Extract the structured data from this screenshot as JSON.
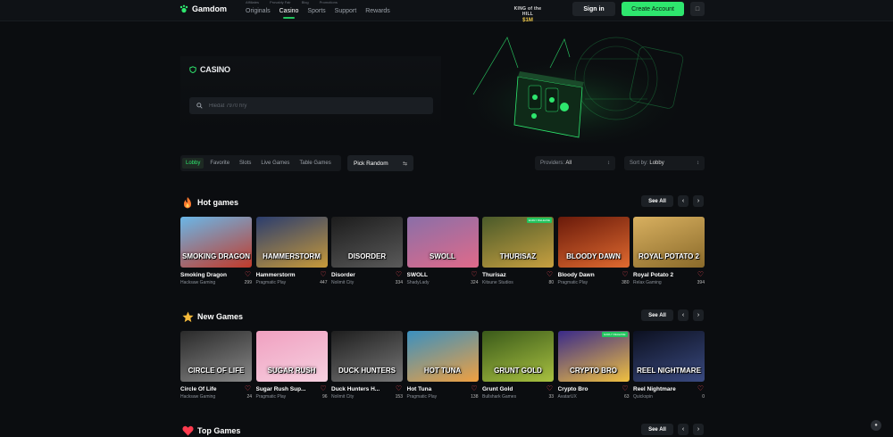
{
  "header": {
    "brand": "Gamdom",
    "subnav": [
      "Affiliates",
      "Provably Fair",
      "Blog",
      "Promotions"
    ],
    "nav": [
      "Originals",
      "Casino",
      "Sports",
      "Support",
      "Rewards"
    ],
    "king_title": "KING of the HILL",
    "king_prize": "$1M",
    "signin": "Sign in",
    "create": "Create Account"
  },
  "hero": {
    "title": "CASINO",
    "search_placeholder": "Hledat 7970 hry"
  },
  "filters": {
    "tabs": [
      "Lobby",
      "Favorite",
      "Slots",
      "Live Games",
      "Table Games"
    ],
    "pick_random": "Pick Random",
    "providers_label": "Providers:",
    "providers_value": "All",
    "sort_label": "Sort by:",
    "sort_value": "Lobby"
  },
  "colors": {
    "accent": "#2ee66e",
    "heart": "#ff4d5a",
    "bg": "#0b0d10"
  },
  "sections": [
    {
      "title": "Hot games",
      "icon": "fire-icon",
      "see_all": "See All",
      "games": [
        {
          "name": "Smoking Dragon",
          "provider": "Hacksaw Gaming",
          "likes": "299",
          "art": "SMOKING DRAGON",
          "badge": ""
        },
        {
          "name": "Hammerstorm",
          "provider": "Pragmatic Play",
          "likes": "447",
          "art": "HAMMERSTORM",
          "badge": ""
        },
        {
          "name": "Disorder",
          "provider": "Nolimit City",
          "likes": "334",
          "art": "DISORDER",
          "badge": ""
        },
        {
          "name": "SWOLL",
          "provider": "ShadyLady",
          "likes": "324",
          "art": "SWOLL",
          "badge": ""
        },
        {
          "name": "Thurisaz",
          "provider": "Kitsune Studios",
          "likes": "80",
          "art": "THURISAZ",
          "badge": "EARLY RELEASE"
        },
        {
          "name": "Bloody Dawn",
          "provider": "Pragmatic Play",
          "likes": "380",
          "art": "BLOODY DAWN",
          "badge": ""
        },
        {
          "name": "Royal Potato 2",
          "provider": "Relax Gaming",
          "likes": "394",
          "art": "ROYAL POTATO 2",
          "badge": ""
        }
      ]
    },
    {
      "title": "New Games",
      "icon": "star-icon",
      "see_all": "See All",
      "games": [
        {
          "name": "Circle Of Life",
          "provider": "Hacksaw Gaming",
          "likes": "24",
          "art": "CIRCLE OF LIFE",
          "badge": ""
        },
        {
          "name": "Sugar Rush Sup...",
          "provider": "Pragmatic Play",
          "likes": "96",
          "art": "SUGAR RUSH",
          "badge": ""
        },
        {
          "name": "Duck Hunters H...",
          "provider": "Nolimit City",
          "likes": "153",
          "art": "DUCK HUNTERS",
          "badge": ""
        },
        {
          "name": "Hot Tuna",
          "provider": "Pragmatic Play",
          "likes": "138",
          "art": "HOT TUNA",
          "badge": ""
        },
        {
          "name": "Grunt Gold",
          "provider": "Bullshark Games",
          "likes": "33",
          "art": "GRUNT GOLD",
          "badge": ""
        },
        {
          "name": "Crypto Bro",
          "provider": "AvatarUX",
          "likes": "63",
          "art": "CRYPTO BRO",
          "badge": "EARLY RELEASE"
        },
        {
          "name": "Reel Nightmare",
          "provider": "Quickspin",
          "likes": "0",
          "art": "REEL NIGHTMARE",
          "badge": ""
        }
      ]
    },
    {
      "title": "Top Games",
      "icon": "heart-icon",
      "see_all": "See All",
      "games": []
    }
  ]
}
